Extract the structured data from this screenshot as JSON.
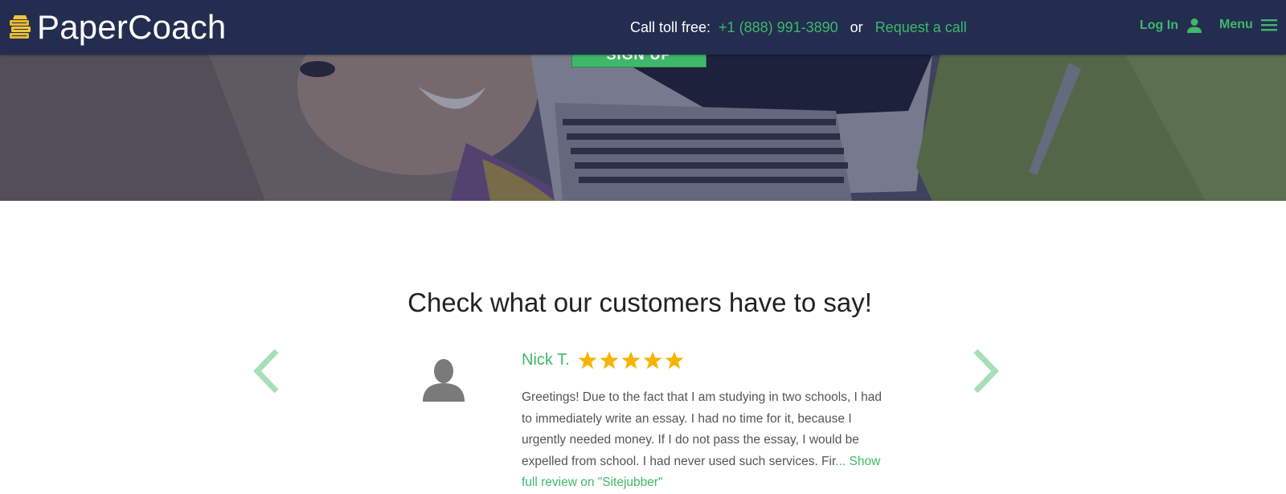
{
  "brand": {
    "name": "PaperCoach",
    "icon": "book-stack-icon",
    "accent_color": "#3fb86a",
    "header_bg": "#232d4f"
  },
  "header": {
    "call_label": "Call toll free:",
    "phone": "+1 (888) 991-3890",
    "or_text": "or",
    "request_call": "Request a call",
    "login_label": "Log In",
    "login_icon": "user-icon",
    "menu_label": "Menu",
    "menu_icon": "hamburger-icon"
  },
  "hero": {
    "signup_label": "SIGN UP"
  },
  "reviews": {
    "title": "Check what our customers have to say!",
    "prev_icon": "chevron-left-icon",
    "next_icon": "chevron-right-icon",
    "items": [
      {
        "name": "Nick T.",
        "rating": 5,
        "avatar_icon": "user-silhouette-icon",
        "text": "Greetings! Due to the fact that I am studying in two schools, I had to immediately write an essay. I had no time for it, because I urgently needed money. If I do not pass the essay, I would be expelled from school. I had never used such services. Fir",
        "more_link": "... Show full review on \"Sitejubber\""
      }
    ]
  }
}
